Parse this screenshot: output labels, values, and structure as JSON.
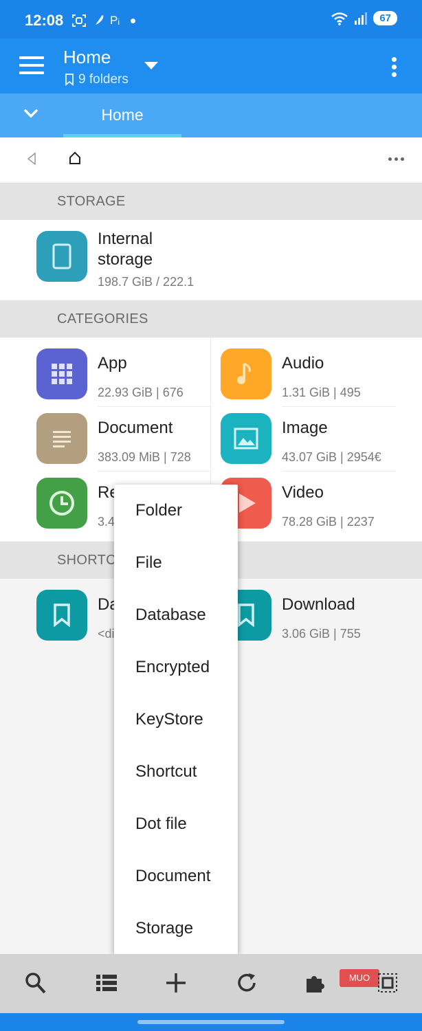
{
  "status_bar": {
    "time": "12:08",
    "extra_label": "Pᵢ",
    "battery": "67"
  },
  "app_bar": {
    "title": "Home",
    "subtitle": "9 folders"
  },
  "tabs": [
    {
      "label": "Home",
      "active": true
    }
  ],
  "sections": {
    "storage": "STORAGE",
    "categories": "CATEGORIES",
    "shortcuts": "SHORTC"
  },
  "storage": [
    {
      "name_line1": "Internal",
      "name_line2": "storage",
      "meta": "198.7 GiB / 222.1",
      "icon": "tablet-icon",
      "color": "#2e9fb8"
    }
  ],
  "categories": [
    {
      "name": "App",
      "meta": "22.93 GiB | 676",
      "icon": "apps-grid-icon",
      "color": "#5b63d3"
    },
    {
      "name": "Audio",
      "meta": "1.31 GiB | 495",
      "icon": "music-note-icon",
      "color": "#ffa726"
    },
    {
      "name": "Document",
      "meta": "383.09 MiB | 728",
      "icon": "document-icon",
      "color": "#b39f7f"
    },
    {
      "name": "Image",
      "meta": "43.07 GiB | 2954€",
      "icon": "image-icon",
      "color": "#1cb3c1"
    },
    {
      "name": "Re",
      "meta": "3.4",
      "icon": "clock-icon",
      "color": "#43a047"
    },
    {
      "name": "Video",
      "meta": "78.28 GiB | 2237",
      "icon": "play-icon",
      "color": "#ef5b4c"
    }
  ],
  "shortcuts": [
    {
      "name": "Da",
      "meta": "<di",
      "icon": "bookmark-icon",
      "color": "#0e9aa2"
    },
    {
      "name": "Download",
      "meta": "3.06 GiB | 755",
      "icon": "bookmark-icon",
      "color": "#0e9aa2"
    }
  ],
  "new_menu": {
    "items": [
      "Folder",
      "File",
      "Database",
      "Encrypted",
      "KeyStore",
      "Shortcut",
      "Dot file",
      "Document",
      "Storage"
    ]
  },
  "bottom_toolbar": {
    "icons": [
      "search-icon",
      "list-view-icon",
      "add-icon",
      "refresh-icon",
      "plugin-icon",
      "select-icon"
    ],
    "watermark": "MUO"
  }
}
